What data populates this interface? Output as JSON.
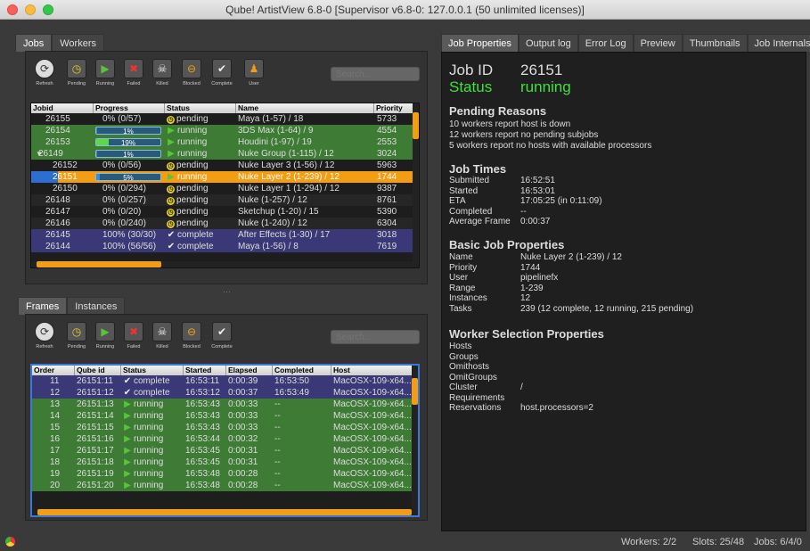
{
  "window": {
    "title": "Qube! ArtistView 6.8-0 [Supervisor v6.8-0: 127.0.0.1 (50 unlimited licenses)]"
  },
  "colors": {
    "running": "#3e7b35",
    "complete": "#3a3876",
    "selected": "#f29d13",
    "pending_icon": "#e2cf2b",
    "progress": "#2f8ee0"
  },
  "top_tabs": [
    {
      "label": "Jobs",
      "active": true
    },
    {
      "label": "Workers",
      "active": false
    }
  ],
  "jobs_toolbar": {
    "buttons": [
      {
        "label": "Refresh",
        "icon": "refresh-icon"
      },
      {
        "label": "Pending",
        "icon": "pending-clock-icon"
      },
      {
        "label": "Running",
        "icon": "play-icon"
      },
      {
        "label": "Failed",
        "icon": "x-icon"
      },
      {
        "label": "Killed",
        "icon": "skull-icon"
      },
      {
        "label": "Blocked",
        "icon": "blocked-icon"
      },
      {
        "label": "Complete",
        "icon": "check-icon"
      },
      {
        "label": "User",
        "icon": "user-icon"
      }
    ],
    "search_placeholder": "Search..."
  },
  "jobs_table": {
    "columns": [
      "Jobid",
      "Progress",
      "Status",
      "Name",
      "Priority"
    ],
    "rows": [
      {
        "id": "26155",
        "indent": 1,
        "progress_text": "0% (0/57)",
        "bar": null,
        "status": "pending",
        "name": "Maya (1-57) / 18",
        "priority": "5733"
      },
      {
        "id": "26154",
        "indent": 1,
        "progress_text": "1%",
        "bar": 0.01,
        "status": "running",
        "name": "3DS Max (1-64) / 9",
        "priority": "4554"
      },
      {
        "id": "26153",
        "indent": 1,
        "progress_text": "19%",
        "bar": 0.19,
        "status": "running",
        "name": "Houdini (1-97) / 19",
        "priority": "2553"
      },
      {
        "id": "26149",
        "indent": 0,
        "expander": "▼",
        "progress_text": "1%",
        "bar": 0.01,
        "status": "running",
        "name": "Nuke Group (1-115) / 12",
        "priority": "3024"
      },
      {
        "id": "26152",
        "indent": 2,
        "progress_text": "0% (0/56)",
        "bar": null,
        "status": "pending",
        "name": "Nuke Layer 3 (1-56) / 12",
        "priority": "5963"
      },
      {
        "id": "26151",
        "indent": 2,
        "progress_text": "5%",
        "bar": 0.05,
        "status": "running",
        "name": "Nuke Layer 2 (1-239) / 12",
        "priority": "1744",
        "selected": true
      },
      {
        "id": "26150",
        "indent": 2,
        "progress_text": "0% (0/294)",
        "bar": null,
        "status": "pending",
        "name": "Nuke Layer 1 (1-294) / 12",
        "priority": "9387"
      },
      {
        "id": "26148",
        "indent": 1,
        "progress_text": "0% (0/257)",
        "bar": null,
        "status": "pending",
        "name": "Nuke (1-257) / 12",
        "priority": "8761"
      },
      {
        "id": "26147",
        "indent": 1,
        "progress_text": "0% (0/20)",
        "bar": null,
        "status": "pending",
        "name": "Sketchup (1-20) / 15",
        "priority": "5390"
      },
      {
        "id": "26146",
        "indent": 1,
        "progress_text": "0% (0/240)",
        "bar": null,
        "status": "pending",
        "name": "Nuke (1-240) / 12",
        "priority": "6304"
      },
      {
        "id": "26145",
        "indent": 1,
        "progress_text": "100% (30/30)",
        "bar": null,
        "status": "complete",
        "name": "After Effects (1-30) / 17",
        "priority": "3018"
      },
      {
        "id": "26144",
        "indent": 1,
        "progress_text": "100% (56/56)",
        "bar": null,
        "status": "complete",
        "name": "Maya (1-56) / 8",
        "priority": "7619"
      }
    ]
  },
  "bottom_tabs": [
    {
      "label": "Frames",
      "active": true
    },
    {
      "label": "Instances",
      "active": false
    }
  ],
  "frames_toolbar": {
    "buttons": [
      {
        "label": "Refresh",
        "icon": "refresh-icon"
      },
      {
        "label": "Pending",
        "icon": "pending-clock-icon"
      },
      {
        "label": "Running",
        "icon": "play-icon"
      },
      {
        "label": "Failed",
        "icon": "x-icon"
      },
      {
        "label": "Killed",
        "icon": "skull-icon"
      },
      {
        "label": "Blocked",
        "icon": "blocked-icon"
      },
      {
        "label": "Complete",
        "icon": "check-icon"
      }
    ],
    "search_placeholder": "Search..."
  },
  "frames_table": {
    "columns": [
      "Order",
      "Qube id",
      "Status",
      "Started",
      "Elapsed",
      "Completed",
      "Host"
    ],
    "rows": [
      {
        "order": "11",
        "qid": "26151:11",
        "status": "complete",
        "started": "16:53:11",
        "elapsed": "0:00:39",
        "completed": "16:53:50",
        "host": "MacOSX-109-x64..."
      },
      {
        "order": "12",
        "qid": "26151:12",
        "status": "complete",
        "started": "16:53:12",
        "elapsed": "0:00:37",
        "completed": "16:53:49",
        "host": "MacOSX-109-x64..."
      },
      {
        "order": "13",
        "qid": "26151:13",
        "status": "running",
        "started": "16:53:43",
        "elapsed": "0:00:33",
        "completed": "--",
        "host": "MacOSX-109-x64..."
      },
      {
        "order": "14",
        "qid": "26151:14",
        "status": "running",
        "started": "16:53:43",
        "elapsed": "0:00:33",
        "completed": "--",
        "host": "MacOSX-109-x64..."
      },
      {
        "order": "15",
        "qid": "26151:15",
        "status": "running",
        "started": "16:53:43",
        "elapsed": "0:00:33",
        "completed": "--",
        "host": "MacOSX-109-x64..."
      },
      {
        "order": "16",
        "qid": "26151:16",
        "status": "running",
        "started": "16:53:44",
        "elapsed": "0:00:32",
        "completed": "--",
        "host": "MacOSX-109-x64..."
      },
      {
        "order": "17",
        "qid": "26151:17",
        "status": "running",
        "started": "16:53:45",
        "elapsed": "0:00:31",
        "completed": "--",
        "host": "MacOSX-109-x64..."
      },
      {
        "order": "18",
        "qid": "26151:18",
        "status": "running",
        "started": "16:53:45",
        "elapsed": "0:00:31",
        "completed": "--",
        "host": "MacOSX-109-x64..."
      },
      {
        "order": "19",
        "qid": "26151:19",
        "status": "running",
        "started": "16:53:48",
        "elapsed": "0:00:28",
        "completed": "--",
        "host": "MacOSX-109-x64..."
      },
      {
        "order": "20",
        "qid": "26151:20",
        "status": "running",
        "started": "16:53:48",
        "elapsed": "0:00:28",
        "completed": "--",
        "host": "MacOSX-109-x64..."
      }
    ]
  },
  "right_tabs": [
    {
      "label": "Job Properties",
      "active": true
    },
    {
      "label": "Output log"
    },
    {
      "label": "Error Log"
    },
    {
      "label": "Preview"
    },
    {
      "label": "Thumbnails"
    },
    {
      "label": "Job Internals"
    }
  ],
  "job": {
    "id_label": "Job ID",
    "id": "26151",
    "status_label": "Status",
    "status": "running"
  },
  "pending_reasons": {
    "title": "Pending Reasons",
    "lines": [
      "10 workers report  host is down",
      "12 workers report  no pending subjobs",
      "5 workers report   no hosts with available processors"
    ]
  },
  "job_times": {
    "title": "Job Times",
    "items": [
      {
        "k": "Submitted",
        "v": "16:52:51"
      },
      {
        "k": "Started",
        "v": "16:53:01"
      },
      {
        "k": "ETA",
        "v": "17:05:25 (in 0:11:09)"
      },
      {
        "k": "Completed",
        "v": "--"
      },
      {
        "k": "Average Frame",
        "v": "0:00:37"
      }
    ]
  },
  "basic_props": {
    "title": "Basic Job Properties",
    "items": [
      {
        "k": "Name",
        "v": "Nuke Layer 2 (1-239) / 12"
      },
      {
        "k": "Priority",
        "v": "1744"
      },
      {
        "k": "User",
        "v": "pipelinefx"
      },
      {
        "k": "Range",
        "v": "1-239"
      },
      {
        "k": "Instances",
        "v": "12"
      },
      {
        "k": "Tasks",
        "v": "239 (12 complete, 12 running, 215 pending)"
      }
    ]
  },
  "worker_props": {
    "title": "Worker Selection Properties",
    "items": [
      {
        "k": "Hosts",
        "v": ""
      },
      {
        "k": "Groups",
        "v": ""
      },
      {
        "k": "Omithosts",
        "v": ""
      },
      {
        "k": "OmitGroups",
        "v": ""
      },
      {
        "k": "Cluster",
        "v": "/"
      },
      {
        "k": "Requirements",
        "v": ""
      },
      {
        "k": "Reservations",
        "v": "host.processors=2"
      }
    ]
  },
  "statusbar": {
    "workers": "Workers: 2/2",
    "slots": "Slots: 25/48",
    "jobs": "Jobs: 6/4/0"
  }
}
